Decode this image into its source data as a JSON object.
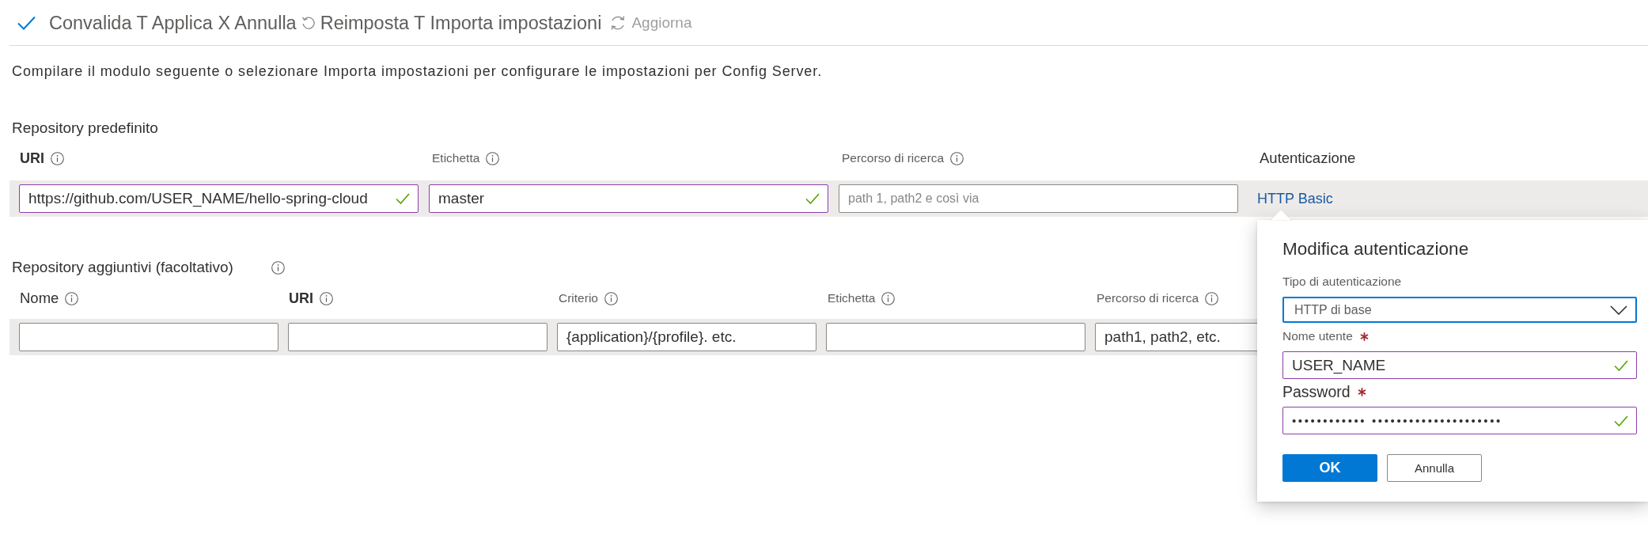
{
  "toolbar": {
    "actions": [
      "Convalida T Applica X Annulla",
      "Reimposta T Importa impostazioni"
    ],
    "refresh": "Aggiorna"
  },
  "description": "Compilare il modulo seguente o selezionare Importa impostazioni per configurare le impostazioni per Config Server.",
  "default_repository": {
    "title": "Repository predefinito",
    "columns": [
      {
        "label": "URI",
        "kind": "bold",
        "info": true
      },
      {
        "label": "Etichetta",
        "kind": "small",
        "info": true
      },
      {
        "label": "Percorso di ricerca",
        "kind": "small",
        "info": true
      },
      {
        "label": "Autenticazione",
        "kind": "plain",
        "info": false
      }
    ],
    "fields": [
      {
        "kind": "input",
        "value": "https://github.com/USER_NAME/hello-spring-cloud",
        "valid": true
      },
      {
        "kind": "input",
        "value": "master",
        "valid": true
      },
      {
        "kind": "input",
        "placeholder": "path 1, path2 e così via",
        "valid": false
      },
      {
        "kind": "link",
        "label": "HTTP Basic"
      }
    ]
  },
  "additional_repositories": {
    "title": "Repository aggiuntivi (facoltativo)",
    "info": true,
    "columns": [
      {
        "label": "Nome",
        "kind": "plain",
        "info": true
      },
      {
        "label": "URI",
        "kind": "bold",
        "info": true
      },
      {
        "label": "Criterio",
        "kind": "small",
        "info": true
      },
      {
        "label": "Etichetta",
        "kind": "small",
        "info": true
      },
      {
        "label": "Percorso di ricerca",
        "kind": "small",
        "info": true
      }
    ],
    "fields": [
      {
        "kind": "input",
        "valid": false
      },
      {
        "kind": "input",
        "valid": false
      },
      {
        "kind": "input",
        "value": "{application}/{profile}. etc.",
        "valid": false
      },
      {
        "kind": "input",
        "valid": false
      },
      {
        "kind": "input",
        "value": "path1, path2, etc.",
        "valid": false
      }
    ]
  },
  "auth_popup": {
    "title": "Modifica autenticazione",
    "fields": [
      {
        "kind": "select",
        "label": {
          "text": "Tipo di autenticazione",
          "kind": "small"
        },
        "value": "HTTP di base",
        "focused": true,
        "required": false
      },
      {
        "kind": "input",
        "label": {
          "text": "Nome utente",
          "kind": "small"
        },
        "value": "USER_NAME",
        "valid": true,
        "required": true
      },
      {
        "kind": "password",
        "label": {
          "text": "Password",
          "kind": "large"
        },
        "value": "•••••••••••• •••••••••••••••••••••",
        "valid": true,
        "required": true
      }
    ],
    "buttons": [
      {
        "label": "OK",
        "kind": "primary"
      },
      {
        "label": "Annulla",
        "kind": "secondary"
      }
    ]
  }
}
